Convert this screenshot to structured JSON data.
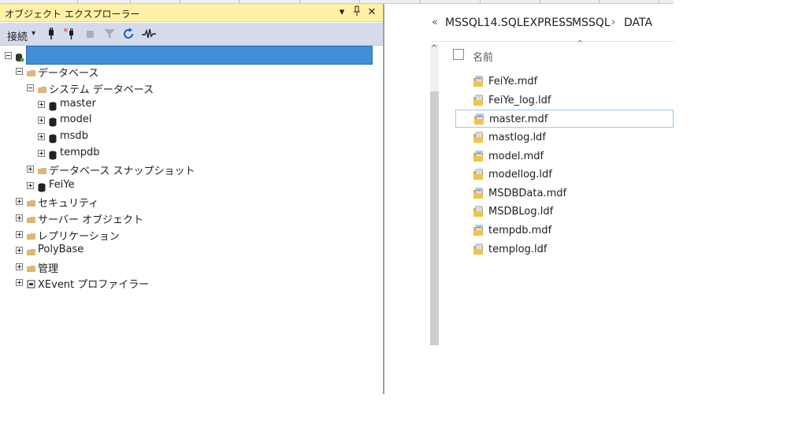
{
  "object_explorer": {
    "title": "オブジェクト エクスプローラー",
    "pin_glyph": "▾",
    "dock_glyph": "ᵻ",
    "close_glyph": "✕",
    "toolbar": {
      "connect_label": "接続",
      "caret": "▾"
    },
    "tree": {
      "server_label": "",
      "databases": "データベース",
      "system_databases": "システム データベース",
      "system_db_items": [
        "master",
        "model",
        "msdb",
        "tempdb"
      ],
      "snapshots": "データベース スナップショット",
      "user_db": "FeiYe",
      "security": "セキュリティ",
      "server_objects": "サーバー オブジェクト",
      "replication": "レプリケーション",
      "polybase": "PolyBase",
      "management": "管理",
      "xevent": "XEvent プロファイラー"
    }
  },
  "file_explorer": {
    "breadcrumb": {
      "overflow": "«",
      "parts": [
        "MSSQL14.SQLEXPRESS",
        "MSSQL",
        "DATA"
      ],
      "separator": "›"
    },
    "column_header": "名前",
    "sort_indicator": "^",
    "scroll_up": "^",
    "files": [
      {
        "name": "FeiYe.mdf",
        "kind": "mdf"
      },
      {
        "name": "FeiYe_log.ldf",
        "kind": "ldf"
      },
      {
        "name": "master.mdf",
        "kind": "mdf",
        "selected": true
      },
      {
        "name": "mastlog.ldf",
        "kind": "ldf"
      },
      {
        "name": "model.mdf",
        "kind": "mdf"
      },
      {
        "name": "modellog.ldf",
        "kind": "ldf"
      },
      {
        "name": "MSDBData.mdf",
        "kind": "mdf"
      },
      {
        "name": "MSDBLog.ldf",
        "kind": "ldf"
      },
      {
        "name": "tempdb.mdf",
        "kind": "mdf"
      },
      {
        "name": "templog.ldf",
        "kind": "ldf"
      }
    ]
  },
  "colors": {
    "title_bar": "#fff2a6",
    "toolbar": "#d5dbea",
    "selection": "#3f8fd6",
    "folder": "#dcb67a",
    "file_select_border": "#99c9ee"
  }
}
